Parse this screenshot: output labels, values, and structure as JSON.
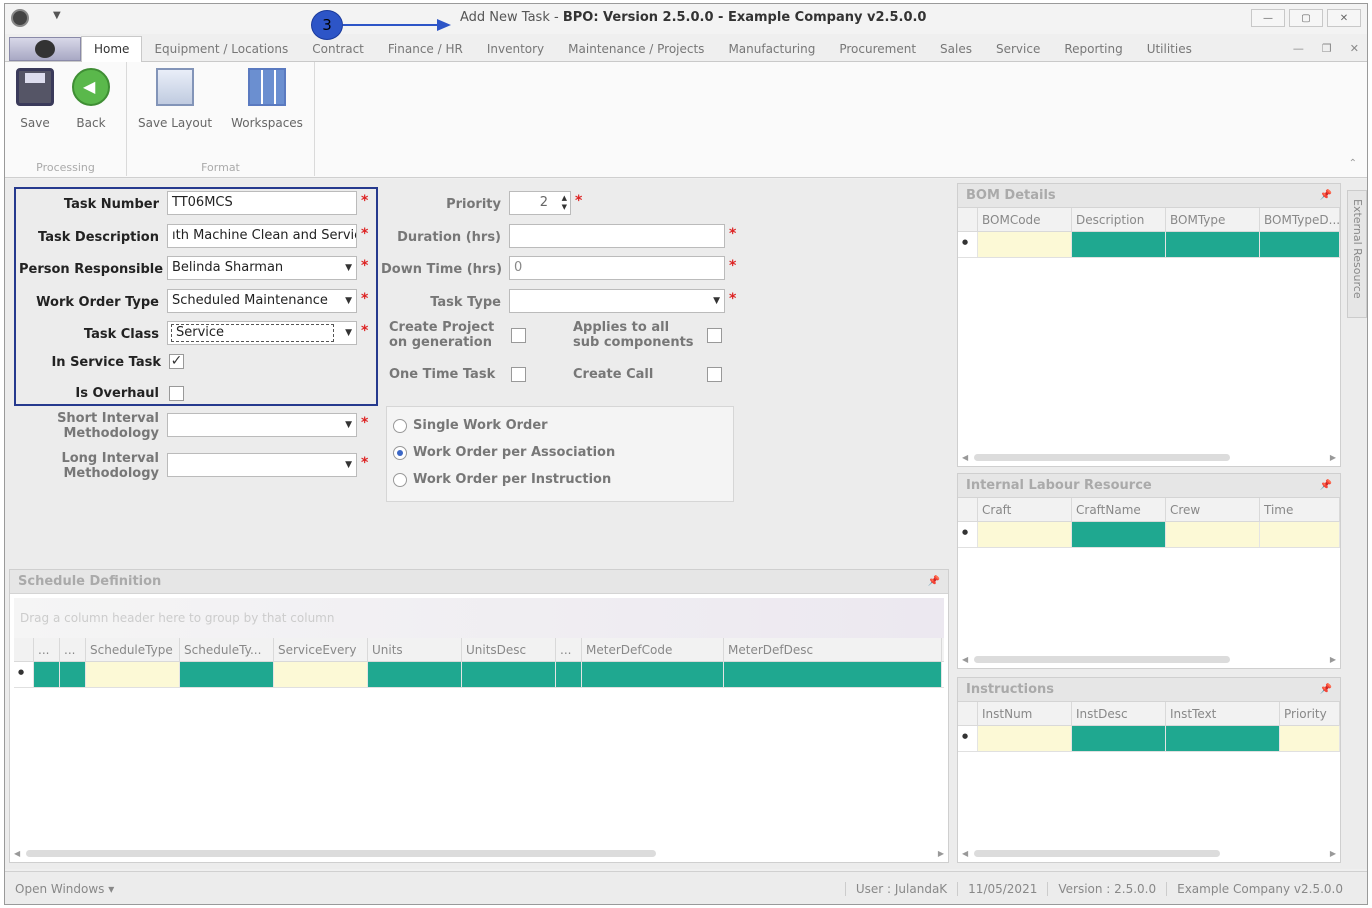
{
  "window": {
    "title_prefix": "Add New Task",
    "title_main": "BPO: Version 2.5.0.0 - Example Company v2.5.0.0",
    "min": "—",
    "max": "▢",
    "close": "✕"
  },
  "callout": {
    "number": "3"
  },
  "tabs": [
    "Home",
    "Equipment / Locations",
    "Contract",
    "Finance / HR",
    "Inventory",
    "Maintenance / Projects",
    "Manufacturing",
    "Procurement",
    "Sales",
    "Service",
    "Reporting",
    "Utilities"
  ],
  "ribbon": {
    "save": "Save",
    "back": "Back",
    "save_layout": "Save Layout",
    "workspaces": "Workspaces",
    "group_processing": "Processing",
    "group_format": "Format"
  },
  "form": {
    "task_number_label": "Task Number",
    "task_number": "TT06MCS",
    "task_description_label": "Task Description",
    "task_description": "ıth Machine Clean and Service",
    "person_responsible_label": "Person Responsible",
    "person_responsible": "Belinda Sharman",
    "work_order_type_label": "Work Order Type",
    "work_order_type": "Scheduled Maintenance",
    "task_class_label": "Task Class",
    "task_class": "Service",
    "in_service_task_label": "In Service Task",
    "is_overhaul_label": "Is Overhaul",
    "short_interval_label": "Short Interval Methodology",
    "long_interval_label": "Long Interval Methodology",
    "priority_label": "Priority",
    "priority": "2",
    "duration_label": "Duration (hrs)",
    "down_time_label": "Down Time (hrs)",
    "down_time": "0",
    "task_type_label": "Task Type",
    "create_project_label": "Create Project on generation",
    "applies_sub_label": "Applies to all sub components",
    "one_time_task_label": "One Time Task",
    "create_call_label": "Create Call",
    "radio_single": "Single Work Order",
    "radio_association": "Work Order per Association",
    "radio_instruction": "Work Order per Instruction"
  },
  "schedule": {
    "title": "Schedule Definition",
    "group_hint": "Drag a column header here to group by that column",
    "columns": [
      "...",
      "...",
      "ScheduleType",
      "ScheduleTy...",
      "ServiceEvery",
      "Units",
      "UnitsDesc",
      "...",
      "MeterDefCode",
      "MeterDefDesc"
    ]
  },
  "bom": {
    "title": "BOM Details",
    "columns": [
      "BOMCode",
      "Description",
      "BOMType",
      "BOMTypeD..."
    ]
  },
  "labour": {
    "title": "Internal Labour Resource",
    "columns": [
      "Craft",
      "CraftName",
      "Crew",
      "Time"
    ]
  },
  "instructions": {
    "title": "Instructions",
    "columns": [
      "InstNum",
      "InstDesc",
      "InstText",
      "Priority"
    ]
  },
  "side_tab": "External Resource",
  "status": {
    "open_windows": "Open Windows ▾",
    "user": "User : JulandaK",
    "date": "11/05/2021",
    "version": "Version : 2.5.0.0",
    "company": "Example Company v2.5.0.0"
  }
}
